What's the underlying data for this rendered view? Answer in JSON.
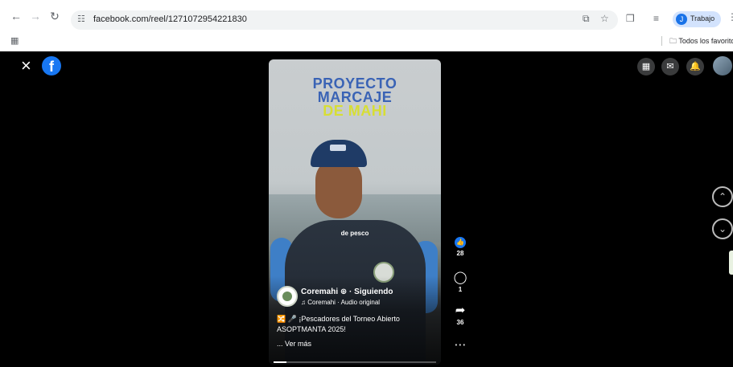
{
  "browser": {
    "url": "facebook.com/reel/1271072954221830",
    "profile_label": "Trabajo",
    "profile_initial": "J",
    "bookmark_folder": "Todos los favoritos"
  },
  "reel": {
    "poster_title_1": "PROYECTO",
    "poster_title_2": "MARCAJE",
    "poster_title_3": "DE MAHI",
    "subtitle": "de pesco",
    "page_name": "Coremahi ⊕ · Siguiendo",
    "audio": "Coremahi · Audio original",
    "text_line_1": "¡Pescadores del Torneo Abierto",
    "text_line_2": "ASOPTMANTA 2025!",
    "see_more": "... Ver más",
    "progress_fraction": 0.08
  },
  "actions": {
    "likes": "28",
    "comments": "1",
    "shares": "36"
  },
  "colors": {
    "facebook_blue": "#1877f2",
    "poster_blue": "#3a63b5",
    "poster_yellow": "#d7de34"
  }
}
